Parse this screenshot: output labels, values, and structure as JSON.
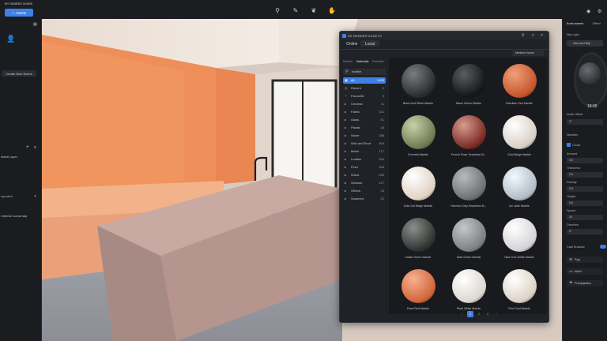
{
  "top_bar": {
    "scene_title": "ter random scene",
    "assets_button": "Assets"
  },
  "left_panel": {
    "create_scene": "Create New Scene",
    "layer_name": "efault Layer",
    "imported_label": "mported",
    "imported_file": "l interior scene.skp"
  },
  "panel": {
    "title": "D5 RENDER ASSETS",
    "tabs": [
      "Online",
      "Local"
    ],
    "active_tab": "Local",
    "subtabs": [
      "Models",
      "Materials",
      "Particles"
    ],
    "active_subtab": "Materials",
    "search_value": "marble",
    "sort_label": "Medium Icons",
    "categories": [
      {
        "icon": "▦",
        "label": "All",
        "count": "1023",
        "selected": true
      },
      {
        "icon": "◷",
        "label": "Recent",
        "count": "4"
      },
      {
        "icon": "♡",
        "label": "Favourite",
        "count": "0"
      },
      {
        "icon": "▸",
        "label": "Ceramic",
        "count": "11"
      },
      {
        "icon": "▸",
        "label": "Fabric",
        "count": "141"
      },
      {
        "icon": "▸",
        "label": "Glass",
        "count": "51"
      },
      {
        "icon": "▸",
        "label": "Plastic",
        "count": "18"
      },
      {
        "icon": "▸",
        "label": "Stone",
        "count": "288"
      },
      {
        "icon": "▸",
        "label": "Wall and Roof",
        "count": "400"
      },
      {
        "icon": "▸",
        "label": "Metal",
        "count": "117"
      },
      {
        "icon": "▸",
        "label": "Leather",
        "count": "164"
      },
      {
        "icon": "▸",
        "label": "Floor",
        "count": "343"
      },
      {
        "icon": "▸",
        "label": "Wood",
        "count": "189"
      },
      {
        "icon": "▸",
        "label": "Outdoor",
        "count": "127"
      },
      {
        "icon": "▸",
        "label": "Others",
        "count": "23"
      },
      {
        "icon": "▸",
        "label": "Scanned",
        "count": "22"
      }
    ],
    "materials": [
      {
        "name": "Black And White Marble",
        "c1": "#7a7c80",
        "c2": "#2a2c30"
      },
      {
        "name": "Black Venus Marble",
        "c1": "#5a5c60",
        "c2": "#151618"
      },
      {
        "name": "Brazilian Red Marble",
        "c1": "#f0a07a",
        "c2": "#c4552c"
      },
      {
        "name": "Emerald Marble",
        "c1": "#c8d0a8",
        "c2": "#6f7a52"
      },
      {
        "name": "French Rose Seamless M...",
        "c1": "#d89a90",
        "c2": "#7a2a22"
      },
      {
        "name": "Gold Beige Marble",
        "c1": "#ffffff",
        "c2": "#d8cfc4"
      },
      {
        "name": "Gold Got Beige Marble",
        "c1": "#ffffff",
        "c2": "#e0d2c4"
      },
      {
        "name": "Hermes Grey Seamless M...",
        "c1": "#b8babd",
        "c2": "#6d6f73"
      },
      {
        "name": "Ice Jade Marble",
        "c1": "#f4f8fc",
        "c2": "#b0bcc8"
      },
      {
        "name": "Indian Green Marble",
        "c1": "#8d8f8c",
        "c2": "#2f3230"
      },
      {
        "name": "Jade Green Marble",
        "c1": "#c4c6c8",
        "c2": "#7c7e80"
      },
      {
        "name": "New York White Marble",
        "c1": "#ffffff",
        "c2": "#d4d4d6"
      },
      {
        "name": "Pearl Red Marble",
        "c1": "#f7b18e",
        "c2": "#d0643a"
      },
      {
        "name": "Pearl White Marble",
        "c1": "#ffffff",
        "c2": "#dcd7d0"
      },
      {
        "name": "Red Gold Marble",
        "c1": "#ffffff",
        "c2": "#ddd1c6"
      }
    ],
    "pages": [
      "‹",
      "1",
      "2",
      "3",
      "›"
    ],
    "current_page": "1"
  },
  "right_panel": {
    "tabs": [
      "Environment",
      "Effect"
    ],
    "sky_label": "Sky Light",
    "sky_value": "Geo and Sky",
    "time": "18:00",
    "north_offset_label": "North Offset",
    "north_offset_value": "0°",
    "weather_label": "Weather",
    "cloud_label": "Cloud",
    "amount_label": "Amount",
    "amount_value": "0.5",
    "thickness_label": "Thickness",
    "thickness_value": "0.5",
    "density_label": "Density",
    "density_value": "0.5",
    "height_label": "Height",
    "height_value": "0.5",
    "speed_label": "Speed",
    "speed_value": "20",
    "direction_label": "Direction",
    "direction_value": "0°",
    "cast_shadow_label": "Cast Shadow",
    "fog_label": "Fog",
    "wind_label": "Wind",
    "precip_label": "Precipitation"
  },
  "colors": {
    "accent": "#3f7fe8",
    "wall": "#f0935c",
    "island": "#b89a94"
  }
}
